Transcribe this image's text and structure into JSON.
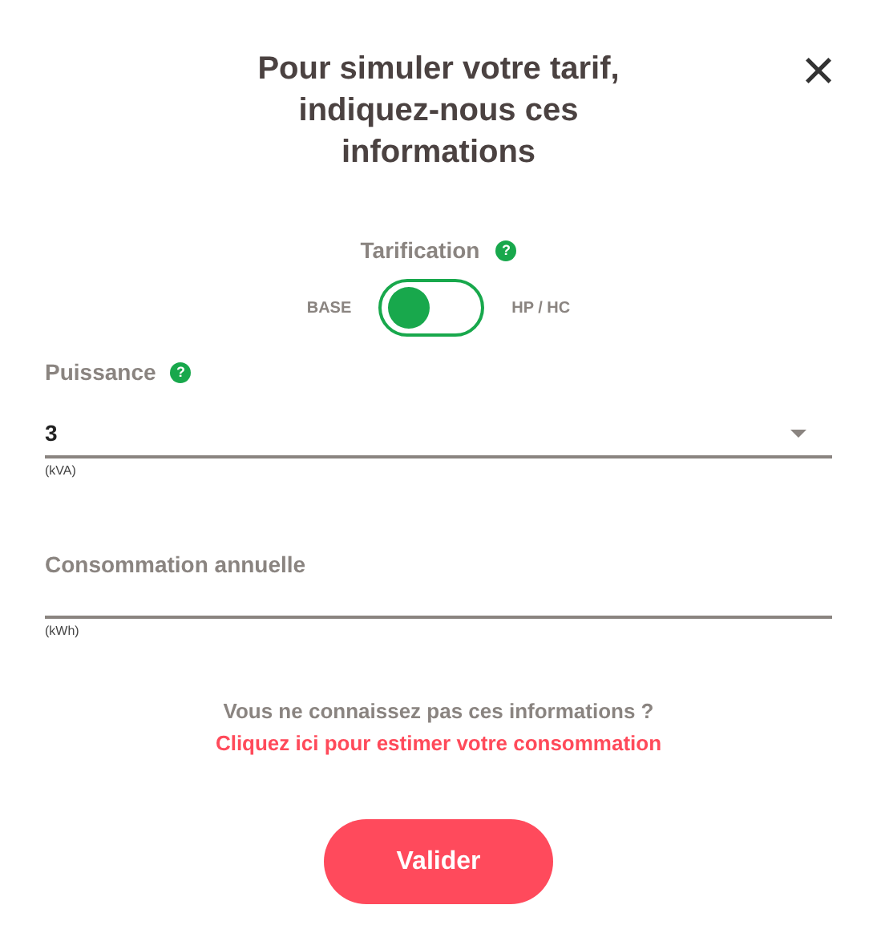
{
  "title": "Pour simuler votre tarif, indiquez-nous ces informations",
  "close": "×",
  "tarification": {
    "label": "Tarification",
    "help": "?",
    "left": "BASE",
    "right": "HP / HC",
    "on": false
  },
  "puissance": {
    "label": "Puissance",
    "help": "?",
    "value": "3",
    "unit": "(kVA)"
  },
  "consommation": {
    "placeholder": "Consommation annuelle",
    "unit": "(kWh)"
  },
  "hint": "Vous ne connaissez pas ces informations ?",
  "link": "Cliquez ici pour estimer votre consommation",
  "button": "Valider"
}
